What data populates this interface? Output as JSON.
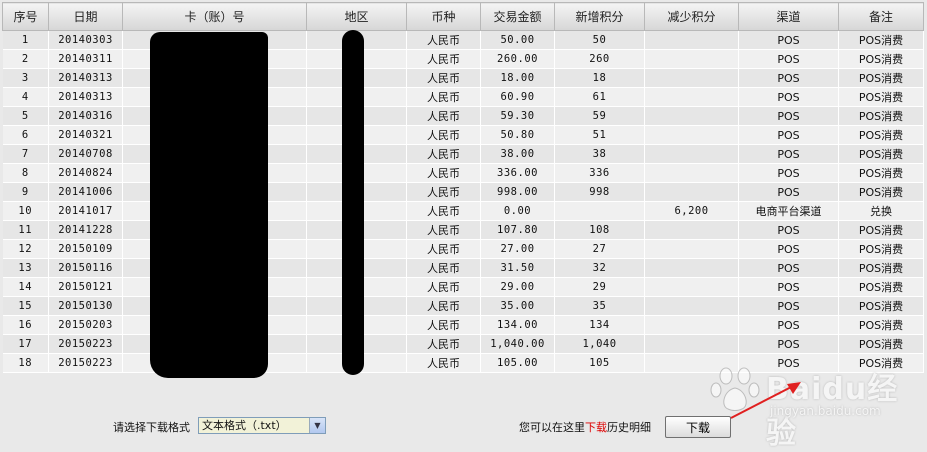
{
  "table": {
    "headers": [
      "序号",
      "日期",
      "卡（账）号",
      "地区",
      "币种",
      "交易金额",
      "新增积分",
      "减少积分",
      "渠道",
      "备注"
    ],
    "rows": [
      [
        "1",
        "20140303",
        "",
        "",
        "人民币",
        "50.00",
        "50",
        "",
        "POS",
        "POS消费"
      ],
      [
        "2",
        "20140311",
        "",
        "",
        "人民币",
        "260.00",
        "260",
        "",
        "POS",
        "POS消费"
      ],
      [
        "3",
        "20140313",
        "",
        "",
        "人民币",
        "18.00",
        "18",
        "",
        "POS",
        "POS消费"
      ],
      [
        "4",
        "20140313",
        "",
        "",
        "人民币",
        "60.90",
        "61",
        "",
        "POS",
        "POS消费"
      ],
      [
        "5",
        "20140316",
        "",
        "",
        "人民币",
        "59.30",
        "59",
        "",
        "POS",
        "POS消费"
      ],
      [
        "6",
        "20140321",
        "",
        "",
        "人民币",
        "50.80",
        "51",
        "",
        "POS",
        "POS消费"
      ],
      [
        "7",
        "20140708",
        "",
        "",
        "人民币",
        "38.00",
        "38",
        "",
        "POS",
        "POS消费"
      ],
      [
        "8",
        "20140824",
        "",
        "",
        "人民币",
        "336.00",
        "336",
        "",
        "POS",
        "POS消费"
      ],
      [
        "9",
        "20141006",
        "",
        "",
        "人民币",
        "998.00",
        "998",
        "",
        "POS",
        "POS消费"
      ],
      [
        "10",
        "20141017",
        "",
        "",
        "人民币",
        "0.00",
        "",
        "6,200",
        "电商平台渠道",
        "兑换"
      ],
      [
        "11",
        "20141228",
        "",
        "",
        "人民币",
        "107.80",
        "108",
        "",
        "POS",
        "POS消费"
      ],
      [
        "12",
        "20150109",
        "",
        "",
        "人民币",
        "27.00",
        "27",
        "",
        "POS",
        "POS消费"
      ],
      [
        "13",
        "20150116",
        "",
        "",
        "人民币",
        "31.50",
        "32",
        "",
        "POS",
        "POS消费"
      ],
      [
        "14",
        "20150121",
        "",
        "",
        "人民币",
        "29.00",
        "29",
        "",
        "POS",
        "POS消费"
      ],
      [
        "15",
        "20150130",
        "",
        "",
        "人民币",
        "35.00",
        "35",
        "",
        "POS",
        "POS消费"
      ],
      [
        "16",
        "20150203",
        "",
        "",
        "人民币",
        "134.00",
        "134",
        "",
        "POS",
        "POS消费"
      ],
      [
        "17",
        "20150223",
        "",
        "",
        "人民币",
        "1,040.00",
        "1,040",
        "",
        "POS",
        "POS消费"
      ],
      [
        "18",
        "20150223",
        "",
        "",
        "人民币",
        "105.00",
        "105",
        "",
        "POS",
        "POS消费"
      ]
    ]
  },
  "footer": {
    "format_label": "请选择下载格式",
    "format_selected": "文本格式（.txt）",
    "history_prefix": "您可以在这里",
    "history_link": "下载",
    "history_suffix": "历史明细",
    "download_button": "下载"
  },
  "watermark": {
    "brand": "Baidu经验",
    "url": "jingyan.baidu.com"
  },
  "colors": {
    "header_bg": "#dcdcdc",
    "row_odd": "#e6e6e6",
    "row_even": "#f0f0f0",
    "link_red": "#dd0000",
    "arrow_red": "#e02020"
  }
}
